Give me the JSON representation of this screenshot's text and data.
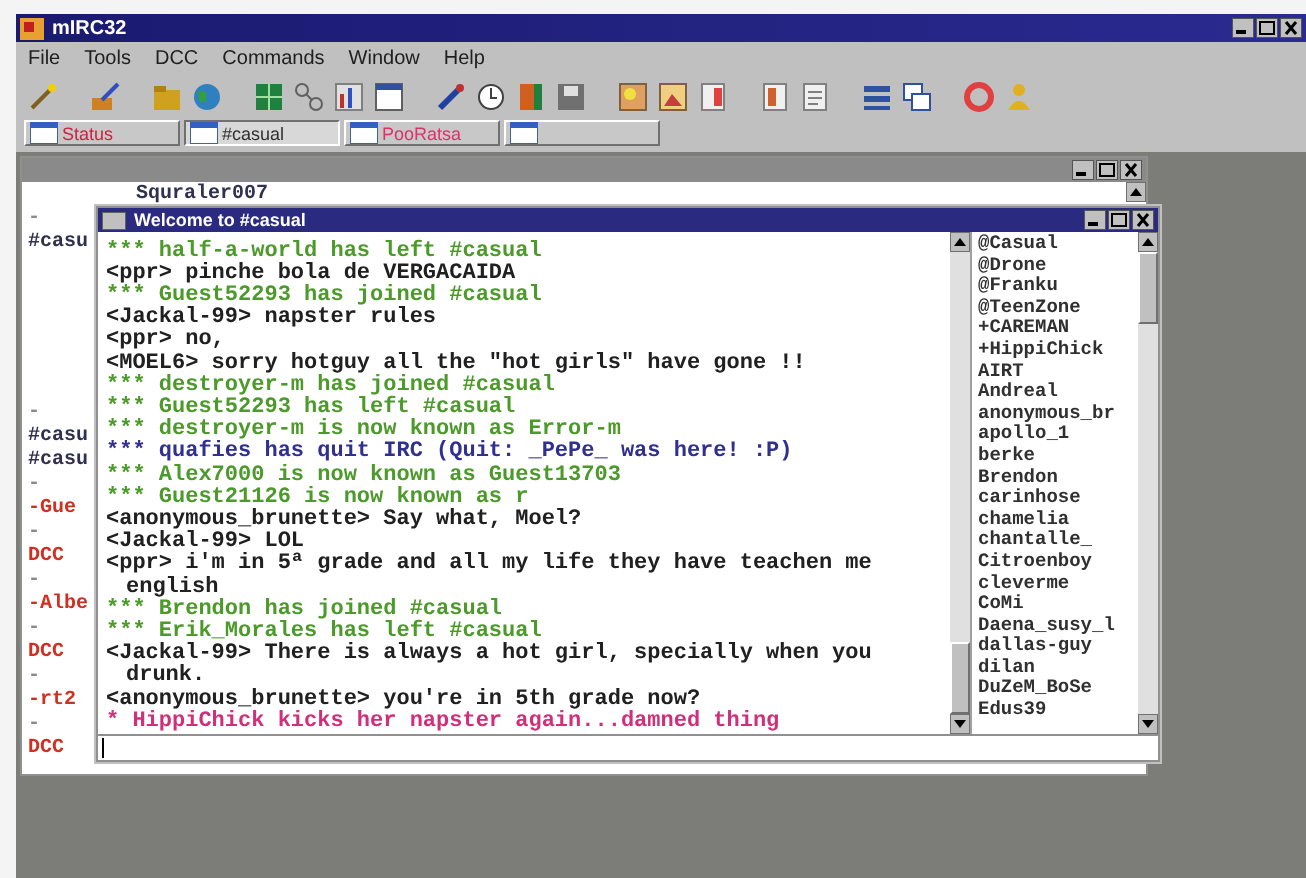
{
  "window": {
    "title": "mIRC32"
  },
  "menu": [
    "File",
    "Tools",
    "DCC",
    "Commands",
    "Window",
    "Help"
  ],
  "switchbar": [
    {
      "label": "Status",
      "selected": false,
      "color": "#d02040"
    },
    {
      "label": "#casual",
      "selected": true,
      "color": "#303030"
    },
    {
      "label": "PooRatsa",
      "selected": false,
      "color": "#e0306a"
    },
    {
      "selected": false
    }
  ],
  "status_window": {
    "active": false,
    "header_line": "Squraler007",
    "top_rows": [
      {
        "text": "-",
        "color": "#8a8a8a"
      },
      {
        "text": "#casu",
        "color": "#303050"
      }
    ],
    "bottom_rows": [
      {
        "text": "-",
        "color": "#8a8a8a"
      },
      {
        "text": "#casu",
        "color": "#303050"
      },
      {
        "text": "#casu",
        "color": "#303050"
      },
      {
        "text": "-",
        "color": "#8a8a8a"
      },
      {
        "text": "-Gue",
        "color": "#d03020"
      },
      {
        "text": "-",
        "color": "#8a8a8a"
      },
      {
        "text": "DCC",
        "color": "#d03020"
      },
      {
        "text": "-",
        "color": "#8a8a8a"
      },
      {
        "text": "-Albe",
        "color": "#d03020"
      },
      {
        "text": "-",
        "color": "#8a8a8a"
      },
      {
        "text": "DCC",
        "color": "#d03020"
      },
      {
        "text": "-",
        "color": "#8a8a8a"
      },
      {
        "text": "-rt2",
        "color": "#d03020"
      },
      {
        "text": "-",
        "color": "#8a8a8a"
      },
      {
        "text": "DCC",
        "color": "#d03020"
      }
    ]
  },
  "channel_window": {
    "active": true,
    "title": "Welcome to #casual",
    "lines": [
      {
        "text": "*** half-a-world has left #casual",
        "color": "#4c9a2a"
      },
      {
        "text": "<ppr> pinche bola de VERGACAIDA",
        "color": "#202020"
      },
      {
        "text": "*** Guest52293 has joined #casual",
        "color": "#4c9a2a"
      },
      {
        "text": "<Jackal-99> napster rules",
        "color": "#202020"
      },
      {
        "text": "<ppr> no,",
        "color": "#202020"
      },
      {
        "text": "<MOEL6> sorry hotguy all the \"hot girls\" have gone !!",
        "color": "#202020"
      },
      {
        "text": "*** destroyer-m has joined #casual",
        "color": "#4c9a2a"
      },
      {
        "text": "*** Guest52293 has left #casual",
        "color": "#4c9a2a"
      },
      {
        "text": "*** destroyer-m is now known as Error-m",
        "color": "#4c9a2a"
      },
      {
        "text": "*** quafies has quit IRC (Quit: _PePe_ was here! :P)",
        "color": "#303090"
      },
      {
        "text": "*** Alex7000 is now known as Guest13703",
        "color": "#4c9a2a"
      },
      {
        "text": "*** Guest21126 is now known as r",
        "color": "#4c9a2a"
      },
      {
        "text": "<anonymous_brunette> Say what, Moel?",
        "color": "#202020"
      },
      {
        "text": "<Jackal-99> LOL",
        "color": "#202020"
      },
      {
        "text": "<ppr> i'm in 5ª grade and all my life they have teachen me english",
        "color": "#202020"
      },
      {
        "text": "*** Brendon has joined #casual",
        "color": "#4c9a2a"
      },
      {
        "text": "*** Erik_Morales has left #casual",
        "color": "#4c9a2a"
      },
      {
        "text": "<Jackal-99> There is always a hot girl, specially when you drunk.",
        "color": "#202020"
      },
      {
        "text": "<anonymous_brunette> you're in 5th grade now?",
        "color": "#202020"
      },
      {
        "text": "* HippiChick kicks her napster again...damned thing",
        "color": "#d0307a"
      }
    ],
    "nicks": [
      "@Casual",
      "@Drone",
      "@Franku",
      "@TeenZone",
      "+CAREMAN",
      "+HippiChick",
      "AIRT",
      "Andreal",
      "anonymous_br",
      "apollo_1",
      "berke",
      "Brendon",
      "carinhose",
      "chamelia",
      "chantalle_",
      "Citroenboy",
      "cleverme",
      "CoMi",
      "Daena_susy_l",
      "dallas-guy",
      "dilan",
      "DuZeM_BoSe",
      "Edus39"
    ]
  }
}
